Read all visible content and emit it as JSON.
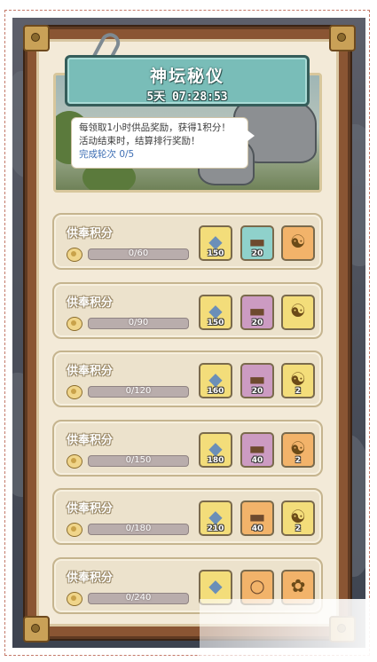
{
  "header": {
    "title": "神坛秘仪",
    "timer": "5天 07:28:53"
  },
  "tooltip": {
    "line1": "每领取1小时供品奖励，获得1积分！",
    "line2": "活动结束时，结算排行奖励！",
    "progress": "完成轮次 0/5"
  },
  "rows": [
    {
      "title": "供奉积分",
      "progress_text": "0/60",
      "progress_fraction": 0,
      "rewards": [
        {
          "icon": "crystal-icon",
          "count": "150",
          "bg": "yellow"
        },
        {
          "icon": "scroll-icon",
          "count": "20",
          "bg": "teal"
        },
        {
          "icon": "yinyang-coin-icon",
          "count": "",
          "bg": "orange"
        }
      ]
    },
    {
      "title": "供奉积分",
      "progress_text": "0/90",
      "progress_fraction": 0,
      "rewards": [
        {
          "icon": "crystal-icon",
          "count": "150",
          "bg": "yellow"
        },
        {
          "icon": "scroll-icon",
          "count": "20",
          "bg": "purple"
        },
        {
          "icon": "yinyang-coin-icon",
          "count": "",
          "bg": "yellow"
        }
      ]
    },
    {
      "title": "供奉积分",
      "progress_text": "0/120",
      "progress_fraction": 0,
      "rewards": [
        {
          "icon": "crystal-icon",
          "count": "160",
          "bg": "yellow"
        },
        {
          "icon": "scroll-icon",
          "count": "20",
          "bg": "purple"
        },
        {
          "icon": "yinyang-coin-icon",
          "count": "2",
          "bg": "yellow"
        }
      ]
    },
    {
      "title": "供奉积分",
      "progress_text": "0/150",
      "progress_fraction": 0,
      "rewards": [
        {
          "icon": "crystal-icon",
          "count": "180",
          "bg": "yellow"
        },
        {
          "icon": "scroll-icon",
          "count": "40",
          "bg": "purple"
        },
        {
          "icon": "yinyang-coin-icon",
          "count": "2",
          "bg": "orange"
        }
      ]
    },
    {
      "title": "供奉积分",
      "progress_text": "0/180",
      "progress_fraction": 0,
      "rewards": [
        {
          "icon": "crystal-icon",
          "count": "210",
          "bg": "yellow"
        },
        {
          "icon": "scroll-icon",
          "count": "40",
          "bg": "orange"
        },
        {
          "icon": "yinyang-coin-icon",
          "count": "2",
          "bg": "yellow"
        }
      ]
    },
    {
      "title": "供奉积分",
      "progress_text": "0/240",
      "progress_fraction": 0,
      "rewards": [
        {
          "icon": "crystal-icon",
          "count": "",
          "bg": "yellow"
        },
        {
          "icon": "bubbles-icon",
          "count": "",
          "bg": "orange"
        },
        {
          "icon": "ornament-icon",
          "count": "",
          "bg": "orange"
        }
      ]
    }
  ],
  "colors": {
    "frame": "#8a5533",
    "panel": "#f3ead8",
    "title_plate": "#79bdb8",
    "progress_text_link": "#3f6fb4"
  }
}
